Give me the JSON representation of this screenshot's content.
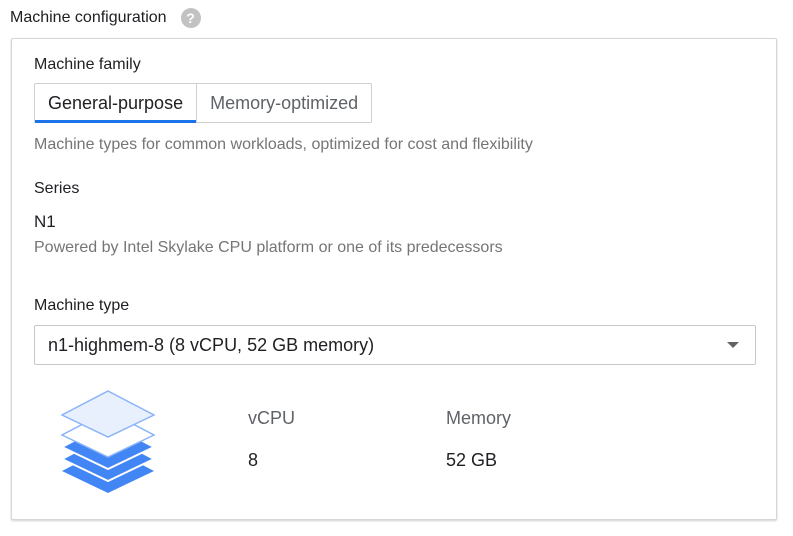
{
  "section": {
    "title": "Machine configuration",
    "help_icon": "help-icon"
  },
  "machine_family": {
    "label": "Machine family",
    "tabs": [
      {
        "label": "General-purpose",
        "active": true
      },
      {
        "label": "Memory-optimized",
        "active": false
      }
    ],
    "description": "Machine types for common workloads, optimized for cost and flexibility"
  },
  "series": {
    "label": "Series",
    "value": "N1",
    "description": "Powered by Intel Skylake CPU platform or one of its predecessors"
  },
  "machine_type": {
    "label": "Machine type",
    "selected": "n1-highmem-8 (8 vCPU, 52 GB memory)",
    "icon": "machine-stack-icon"
  },
  "specs": {
    "vcpu_label": "vCPU",
    "vcpu_value": "8",
    "memory_label": "Memory",
    "memory_value": "52 GB"
  },
  "colors": {
    "accent": "#1a73e8",
    "icon_fill": "#4285f4"
  }
}
